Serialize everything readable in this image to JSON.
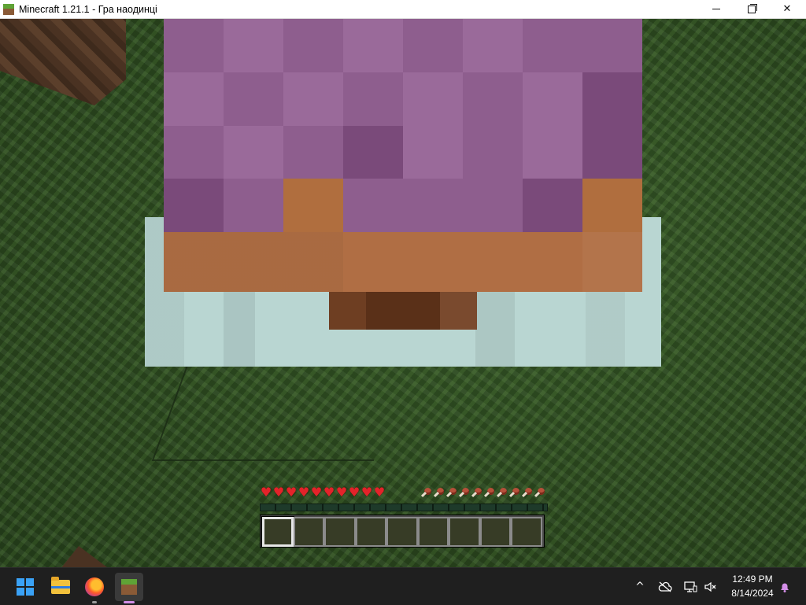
{
  "window": {
    "title": "Minecraft 1.21.1 - Гра наодинці",
    "controls": {
      "minimize": "minimize",
      "maximize": "maximize",
      "close": "close"
    }
  },
  "hud": {
    "health_hearts": 10,
    "food_icons": 10,
    "heart_glyph": "♥",
    "hotbar_slots": 9,
    "selected_slot": 1,
    "heart_color": "#e3232a"
  },
  "taskbar": {
    "apps": [
      {
        "name": "start-button",
        "icon": "windows-logo-icon"
      },
      {
        "name": "file-explorer",
        "icon": "folder-icon"
      },
      {
        "name": "firefox",
        "icon": "firefox-icon"
      },
      {
        "name": "minecraft",
        "icon": "minecraft-grass-block-icon",
        "active": true
      }
    ],
    "tray": {
      "chevron": "^",
      "icons": [
        "cloud-off-icon",
        "network-icon",
        "volume-muted-icon",
        "notification-bell-icon"
      ]
    },
    "clock": {
      "time": "12:49 PM",
      "date": "8/14/2024"
    }
  },
  "colors": {
    "taskbar_bg": "#1f1f1f",
    "hair": "#8e5e8e",
    "skin": "#b06e44",
    "ice_block": "#b9d6d2",
    "grass": "#2f4a22"
  }
}
